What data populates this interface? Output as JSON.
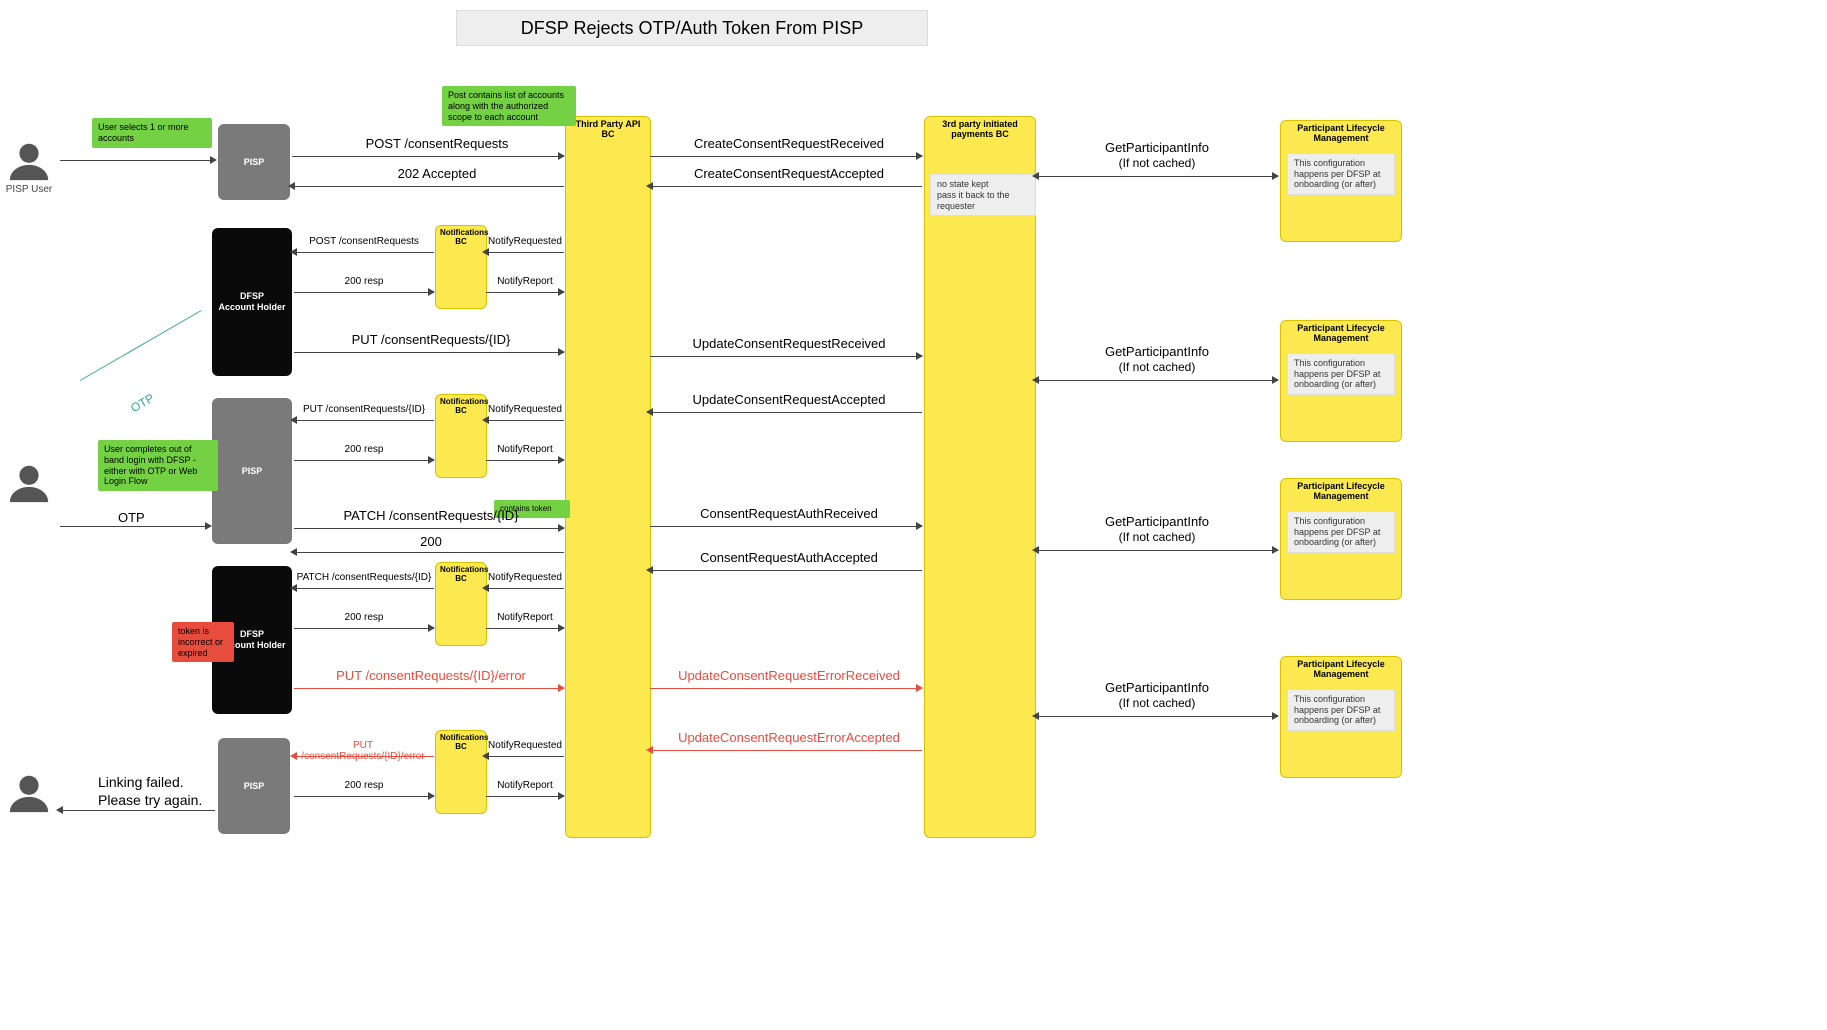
{
  "title": "DFSP Rejects OTP/Auth Token From PISP",
  "actors": {
    "pisp_user": "PISP User",
    "pisp": "PISP",
    "dfsp_account_holder": "DFSP\nAccount Holder"
  },
  "lanes": {
    "third_party_api": "Third Party API BC",
    "notifications_bc": "Notifications BC",
    "third_party_payments": "3rd party initiated payments BC",
    "participant_lifecycle": "Participant Lifecycle Management"
  },
  "notes": {
    "user_selects": "User selects 1 or more accounts",
    "post_contains": "Post contains list of accounts along with the authorized scope to each account",
    "no_state": "no state kept\npass it back to the requester",
    "plm_config": "This configuration happens per DFSP at onboarding (or after)",
    "user_completes": "User completes out of band login with DFSP - either with OTP or Web Login Flow",
    "contains_token": "contains token",
    "token_incorrect": "token is incorrect or expired"
  },
  "messages": {
    "post_consent": "POST /consentRequests",
    "accepted_202": "202 Accepted",
    "resp_200": "200 resp",
    "code_200": "200",
    "put_consent_id": "PUT /consentRequests/{ID}",
    "patch_consent_id": "PATCH /consentRequests/{ID}",
    "put_consent_error": "PUT /consentRequests/{ID}/error",
    "notify_requested": "NotifyRequested",
    "notify_report": "NotifyReport",
    "create_received": "CreateConsentRequestReceived",
    "create_accepted": "CreateConsentRequestAccepted",
    "update_received": "UpdateConsentRequestReceived",
    "update_accepted": "UpdateConsentRequestAccepted",
    "auth_received": "ConsentRequestAuthReceived",
    "auth_accepted": "ConsentRequestAuthAccepted",
    "error_received": "UpdateConsentRequestErrorReceived",
    "error_accepted": "UpdateConsentRequestErrorAccepted",
    "get_participant": "GetParticipantInfo",
    "if_not_cached": "(If not cached)",
    "otp": "OTP",
    "linking_failed": "Linking failed.",
    "please_try": "Please try again."
  }
}
